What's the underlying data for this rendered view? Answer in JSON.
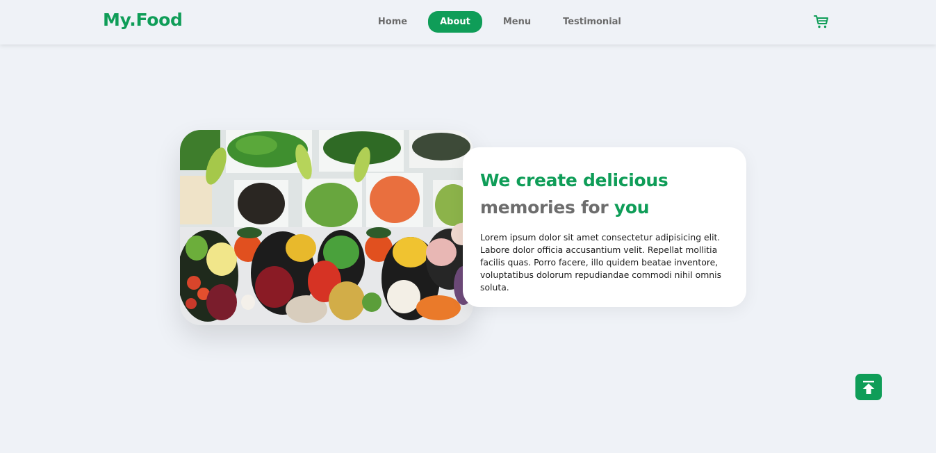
{
  "brand": {
    "logo": "My.Food"
  },
  "nav": {
    "items": [
      {
        "label": "Home",
        "active": false
      },
      {
        "label": "About",
        "active": true
      },
      {
        "label": "Menu",
        "active": false
      },
      {
        "label": "Testimonial",
        "active": false
      }
    ],
    "cart_icon": "shopping-cart-icon"
  },
  "hero": {
    "image_alt": "Overhead view of bowls of fresh vegetables, olives, beans and salads",
    "headline": {
      "part1": "We create ",
      "part2": "delicious",
      "part3": "memories for ",
      "part4": "you"
    },
    "description": "Lorem ipsum dolor sit amet consectetur adipisicing elit. Labore dolor officia accusantium velit. Repellat mollitia facilis quas. Porro facere, illo quidem beatae inventore, voluptatibus dolorum repudiandae commodi nihil omnis soluta."
  },
  "scroll_top_icon": "arrow-up-to-top-icon",
  "colors": {
    "accent": "#0f9d58",
    "background": "#eff2f7",
    "card": "#ffffff"
  }
}
